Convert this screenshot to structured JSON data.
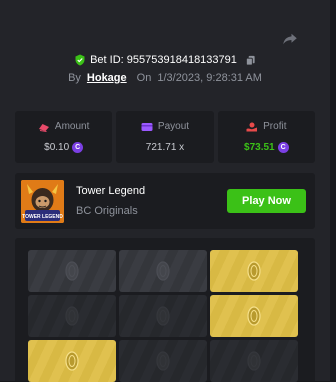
{
  "bet": {
    "id_label": "Bet ID: 955753918418133791",
    "by_label": "By",
    "user": "Hokage",
    "on_label": "On",
    "datetime": "1/3/2023, 9:28:31 AM"
  },
  "stats": [
    {
      "label": "Amount",
      "value": "$0.10",
      "coin": "C",
      "icon": "coins-icon",
      "color": "#e84a6a"
    },
    {
      "label": "Payout",
      "value": "721.71 x",
      "coin": "",
      "icon": "card-icon",
      "color": "#9b59ff"
    },
    {
      "label": "Profit",
      "value": "$73.51",
      "coin": "C",
      "icon": "profit-icon",
      "color": "#e84a4a"
    }
  ],
  "game": {
    "name": "Tower Legend",
    "provider": "BC Originals",
    "thumb_text": "TOWER LEGEND",
    "play_label": "Play Now"
  },
  "board": {
    "tiles": [
      "dark",
      "dark",
      "gold",
      "dim",
      "dim",
      "gold",
      "gold",
      "dim",
      "dim"
    ]
  },
  "colors": {
    "accent_green": "#3bc117",
    "gold_tile": "#e0c14f",
    "panel": "#232429"
  }
}
